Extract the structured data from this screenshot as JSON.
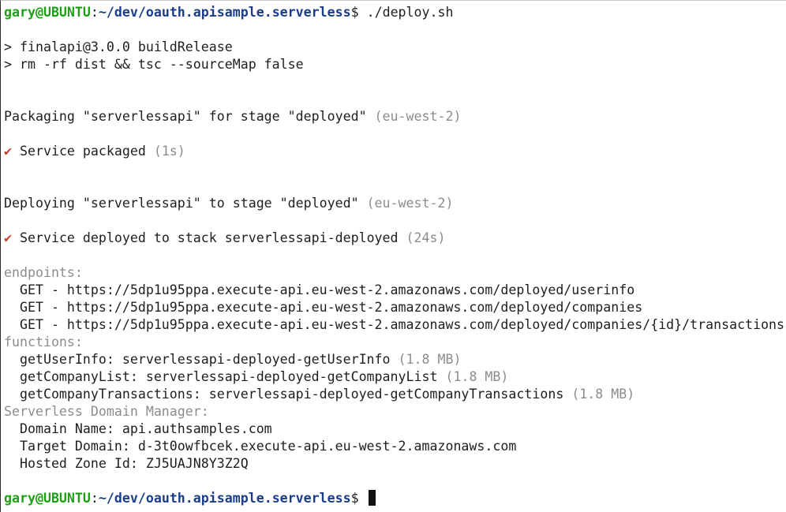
{
  "prompt": {
    "user_host": "gary@UBUNTU",
    "colon": ":",
    "path": "~/dev/oauth.apisample.serverless",
    "dollar": "$",
    "command": " ./deploy.sh"
  },
  "npm": {
    "script_line": "> finalapi@3.0.0 buildRelease",
    "cmd_line": "> rm -rf dist && tsc --sourceMap false"
  },
  "packaging": {
    "text": "Packaging \"serverlessapi\" for stage \"deployed\" ",
    "region": "(eu-west-2)",
    "check": "✔",
    "done_text": " Service packaged ",
    "duration": "(1s)"
  },
  "deploying": {
    "text": "Deploying \"serverlessapi\" to stage \"deployed\" ",
    "region": "(eu-west-2)",
    "check": "✔",
    "done_text": " Service deployed to stack serverlessapi-deployed ",
    "duration": "(24s)"
  },
  "endpoints": {
    "header": "endpoints:",
    "items": [
      "  GET - https://5dp1u95ppa.execute-api.eu-west-2.amazonaws.com/deployed/userinfo",
      "  GET - https://5dp1u95ppa.execute-api.eu-west-2.amazonaws.com/deployed/companies",
      "  GET - https://5dp1u95ppa.execute-api.eu-west-2.amazonaws.com/deployed/companies/{id}/transactions"
    ]
  },
  "functions": {
    "header": "functions:",
    "items": [
      {
        "text": "  getUserInfo: serverlessapi-deployed-getUserInfo ",
        "size": "(1.8 MB)"
      },
      {
        "text": "  getCompanyList: serverlessapi-deployed-getCompanyList ",
        "size": "(1.8 MB)"
      },
      {
        "text": "  getCompanyTransactions: serverlessapi-deployed-getCompanyTransactions ",
        "size": "(1.8 MB)"
      }
    ]
  },
  "domain_manager": {
    "header": "Serverless Domain Manager:",
    "items": [
      "  Domain Name: api.authsamples.com",
      "  Target Domain: d-3t0owfbcek.execute-api.eu-west-2.amazonaws.com",
      "  Hosted Zone Id: ZJ5UAJN8Y3Z2Q"
    ]
  },
  "prompt_end": {
    "user_host": "gary@UBUNTU",
    "colon": ":",
    "path": "~/dev/oauth.apisample.serverless",
    "dollar": "$",
    "command": " "
  },
  "colors": {
    "user_host": "#1f9e17",
    "path": "#1a3e8c",
    "muted": "#8c8c8c",
    "check": "#c93b2b"
  }
}
